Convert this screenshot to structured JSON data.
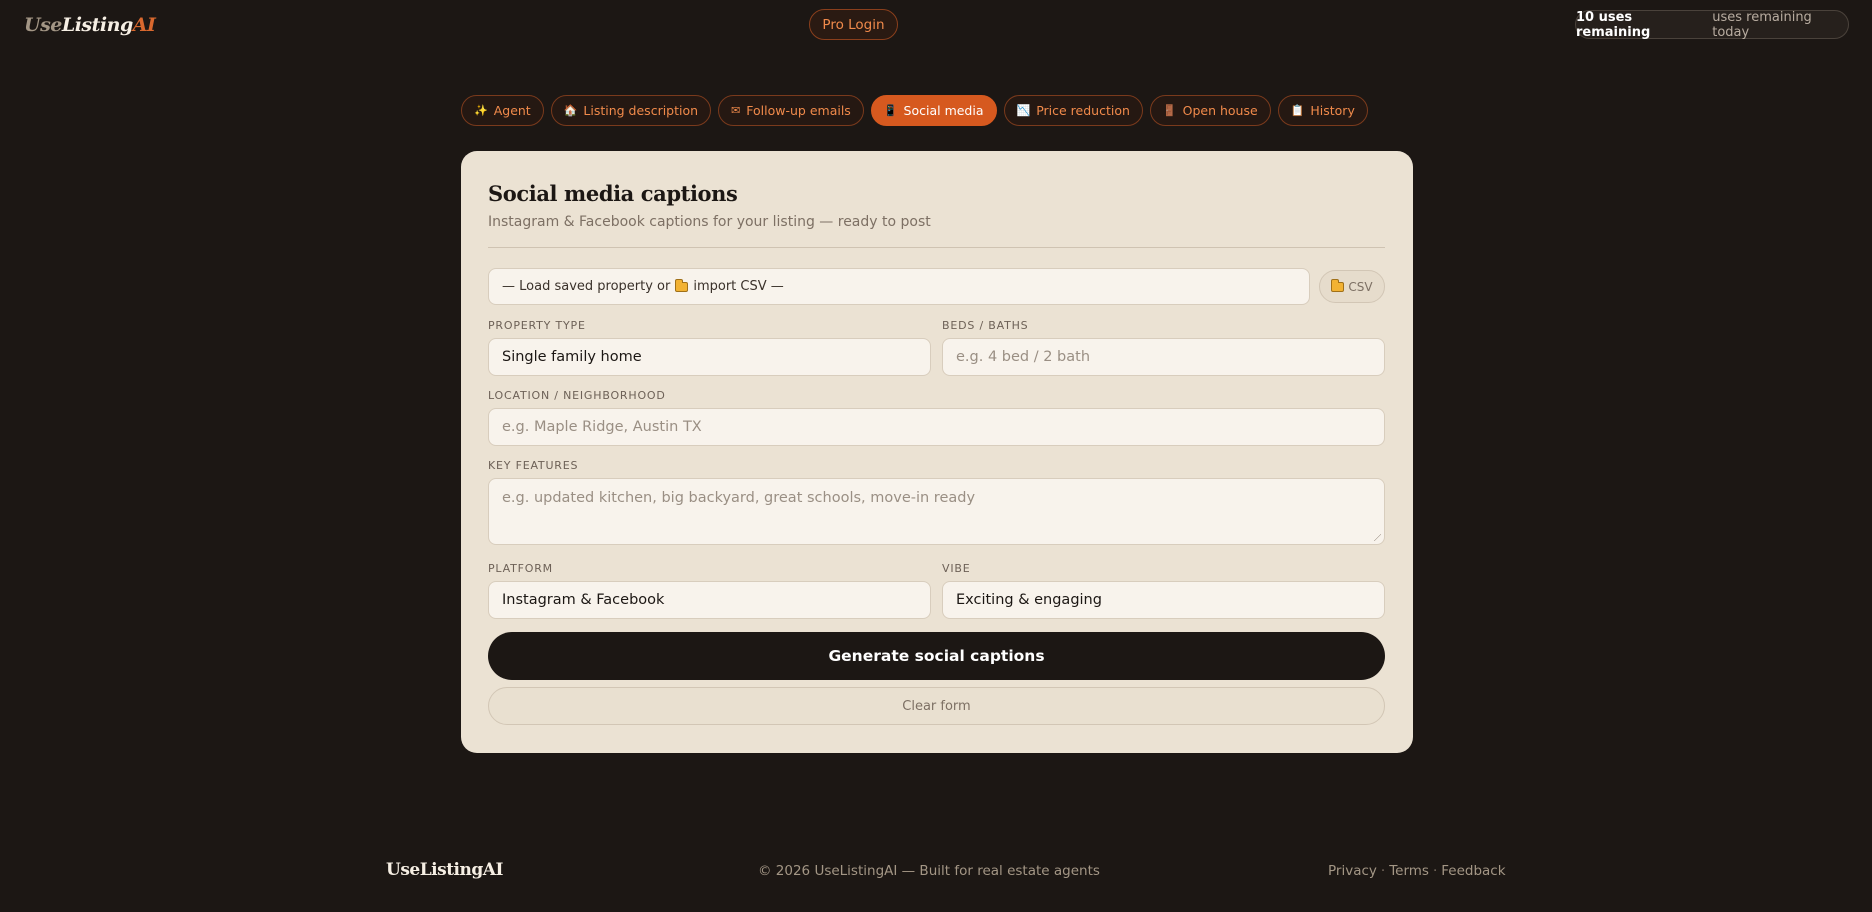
{
  "header": {
    "logo": {
      "part1": "Use",
      "part2": "Listing",
      "part3": "AI"
    },
    "pro_login": "Pro Login",
    "uses_count": "10 uses remaining",
    "uses_text": "uses remaining today"
  },
  "tabs": [
    {
      "icon": "✨",
      "label": "Agent",
      "active": false
    },
    {
      "icon": "🏠",
      "label": "Listing description",
      "active": false
    },
    {
      "icon": "✉",
      "label": "Follow-up emails",
      "active": false
    },
    {
      "icon": "📱",
      "label": "Social media",
      "active": true
    },
    {
      "icon": "📉",
      "label": "Price reduction",
      "active": false
    },
    {
      "icon": "🚪",
      "label": "Open house",
      "active": false
    },
    {
      "icon": "📋",
      "label": "History",
      "active": false
    }
  ],
  "card": {
    "title": "Social media captions",
    "subtitle": "Instagram & Facebook captions for your listing — ready to post",
    "load_select": {
      "prefix": "— Load saved property or",
      "suffix": "import CSV —"
    },
    "csv_button": "CSV",
    "property_type": {
      "label": "PROPERTY TYPE",
      "value": "Single family home"
    },
    "beds_baths": {
      "label": "BEDS / BATHS",
      "placeholder": "e.g. 4 bed / 2 bath"
    },
    "location": {
      "label": "LOCATION / NEIGHBORHOOD",
      "placeholder": "e.g. Maple Ridge, Austin TX"
    },
    "key_features": {
      "label": "KEY FEATURES",
      "placeholder": "e.g. updated kitchen, big backyard, great schools, move-in ready"
    },
    "platform": {
      "label": "PLATFORM",
      "value": "Instagram & Facebook"
    },
    "vibe": {
      "label": "VIBE",
      "value": "Exciting & engaging"
    },
    "generate_button": "Generate social captions",
    "clear_button": "Clear form"
  },
  "footer": {
    "logo": "UseListingAI",
    "copyright": "© 2026 UseListingAI — Built for real estate agents",
    "links": [
      "Privacy",
      "Terms",
      "Feedback"
    ],
    "separator": "·"
  },
  "colors": {
    "background": "#1c1714",
    "accent": "#d6591f",
    "card": "#ebe2d3"
  }
}
